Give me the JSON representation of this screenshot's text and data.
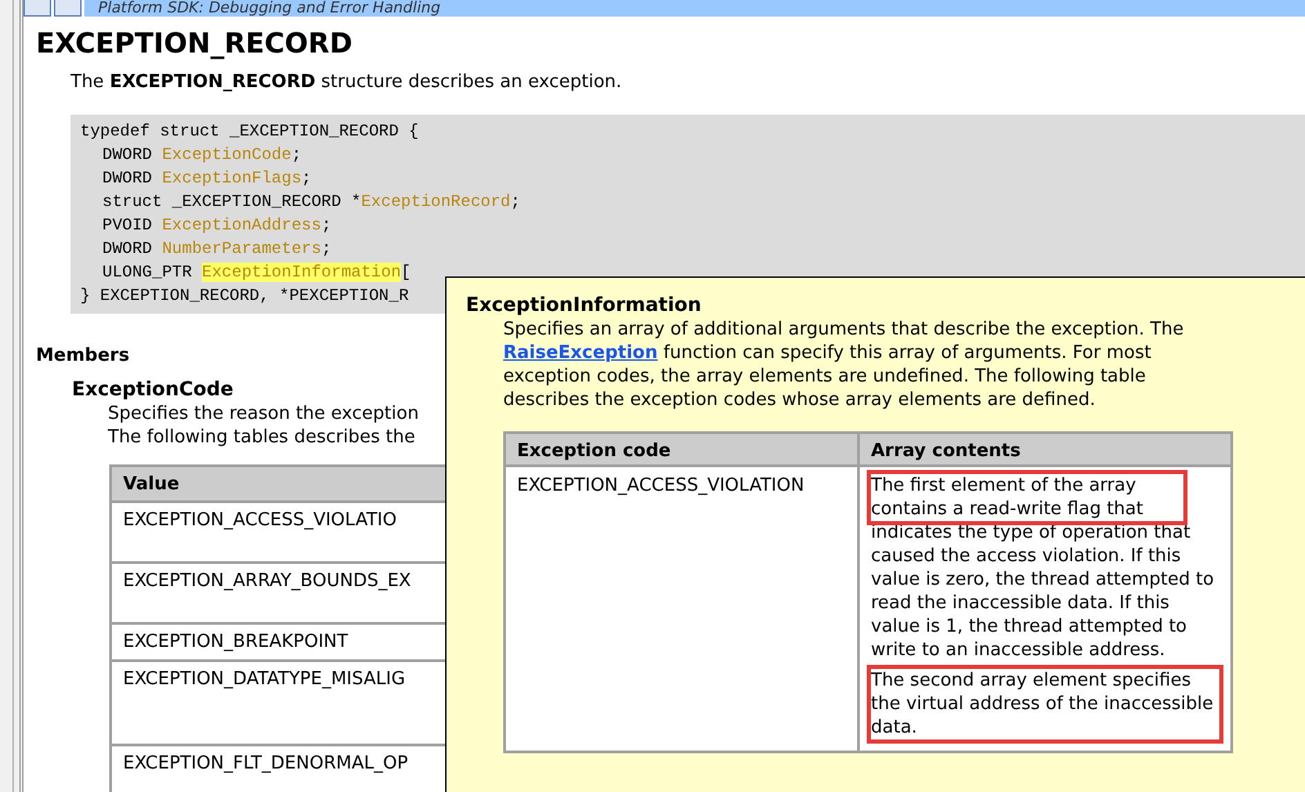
{
  "header": {
    "title": "Platform SDK: Debugging and Error Handling"
  },
  "page": {
    "title": "EXCEPTION_RECORD",
    "intro": "The **EXCEPTION_RECORD** structure describes an exception.",
    "code": {
      "open": "typedef struct _EXCEPTION_RECORD {",
      "fields": [
        {
          "type": "DWORD",
          "name": "ExceptionCode",
          "suffix": ";",
          "highlighted": false
        },
        {
          "type": "DWORD",
          "name": "ExceptionFlags",
          "suffix": ";",
          "highlighted": false
        },
        {
          "type": "struct _EXCEPTION_RECORD",
          "prefix": "*",
          "name": "ExceptionRecord",
          "suffix": ";",
          "highlighted": false
        },
        {
          "type": "PVOID",
          "name": "ExceptionAddress",
          "suffix": ";",
          "highlighted": false
        },
        {
          "type": "DWORD",
          "name": "NumberParameters",
          "suffix": ";",
          "highlighted": false
        },
        {
          "type": "ULONG_PTR",
          "name": "ExceptionInformation",
          "suffix": "[",
          "highlighted": true
        }
      ],
      "close": "} EXCEPTION_RECORD, *PEXCEPTION_R"
    },
    "members_heading": "Members",
    "member": {
      "name": "ExceptionCode",
      "lines": [
        "Specifies the reason the exception",
        "The following tables describes the"
      ],
      "table": {
        "columns": [
          "Value"
        ],
        "rows": [
          {
            "value": "EXCEPTION_ACCESS_VIOLATIO",
            "kind": "tall"
          },
          {
            "value": "EXCEPTION_ARRAY_BOUNDS_EX",
            "kind": "tall"
          },
          {
            "value": "EXCEPTION_BREAKPOINT",
            "kind": "short"
          },
          {
            "value": "EXCEPTION_DATATYPE_MISALIG",
            "kind": "taller"
          },
          {
            "value": "EXCEPTION_FLT_DENORMAL_OP",
            "kind": "tall"
          }
        ]
      }
    }
  },
  "popup": {
    "title": "ExceptionInformation",
    "text_before": "Specifies an array of additional arguments that describe the exception. The ",
    "link": "RaiseException",
    "text_after": " function can specify this array of arguments. For most exception codes, the array elements are undefined. The following table describes the exception codes whose array elements are defined.",
    "table": {
      "columns": [
        "Exception code",
        "Array contents"
      ],
      "rows": [
        {
          "code": "EXCEPTION_ACCESS_VIOLATION",
          "contents": [
            {
              "parts": [
                {
                  "text": "The first element of the array contains a read-write flag that",
                  "boxed": true
                },
                {
                  "text": "indicates the type of operation that caused the access violation. If this value is zero, the thread attempted to read the inaccessible data. If this value is 1, the thread attempted to write to an inaccessible address.",
                  "boxed": false
                }
              ]
            },
            {
              "parts": [
                {
                  "text": "The second array element specifies the virtual address of the inaccessible data.",
                  "boxed": true
                }
              ]
            }
          ]
        }
      ]
    }
  }
}
